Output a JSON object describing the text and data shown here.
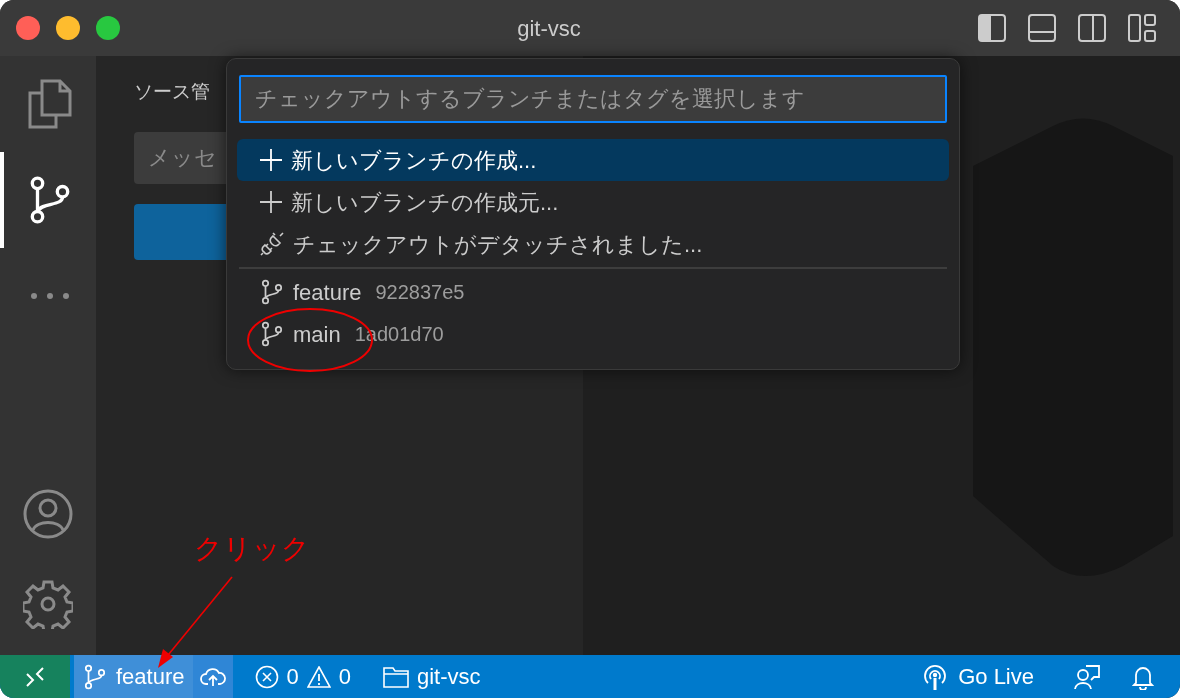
{
  "window": {
    "title": "git-vsc"
  },
  "activity_bar": {
    "items": [
      {
        "kind": "files",
        "selected": false
      },
      {
        "kind": "source-control",
        "selected": true
      },
      {
        "kind": "more",
        "selected": false
      }
    ]
  },
  "sidebar": {
    "title": "ソース管",
    "message_placeholder": "メッセ"
  },
  "quick_pick": {
    "placeholder": "チェックアウトするブランチまたはタグを選択します",
    "items": [
      {
        "kind": "create",
        "label": "新しいブランチの作成...",
        "selected": true
      },
      {
        "kind": "create",
        "label": "新しいブランチの作成元...",
        "selected": false
      },
      {
        "kind": "detach",
        "label": "チェックアウトがデタッチされました...",
        "selected": false
      },
      {
        "kind": "branch",
        "label": "feature",
        "detail": "922837e5",
        "selected": false
      },
      {
        "kind": "branch",
        "label": "main",
        "detail": "1ad01d70",
        "selected": false
      }
    ]
  },
  "status_bar": {
    "branch": "feature",
    "errors": "0",
    "warnings": "0",
    "folder": "git-vsc",
    "go_live": "Go Live"
  },
  "annotation": {
    "text": "クリック"
  }
}
